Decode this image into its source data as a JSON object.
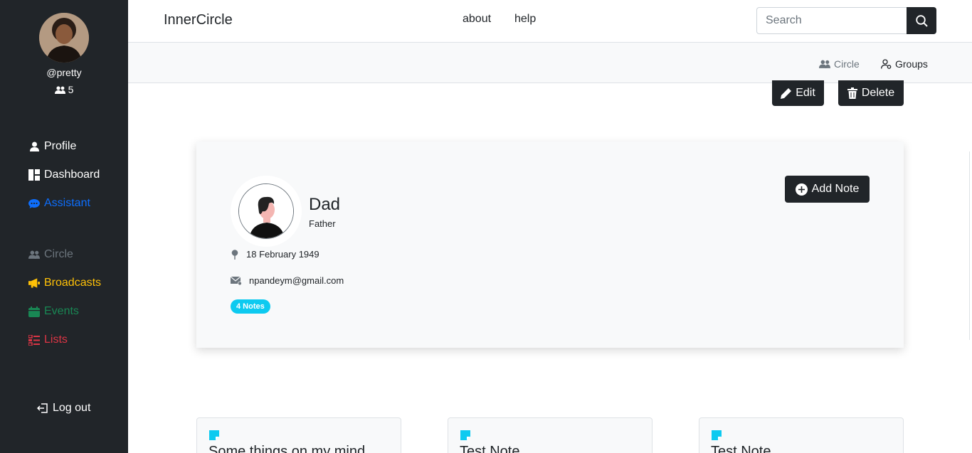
{
  "sidebar": {
    "username": "@pretty",
    "friend_count": "5",
    "nav": [
      {
        "label": "Profile",
        "color": "#ffffff",
        "icon": "person-icon"
      },
      {
        "label": "Dashboard",
        "color": "#ffffff",
        "icon": "dashboard-icon"
      },
      {
        "label": "Assistant",
        "color": "#0d6efd",
        "icon": "chat-icon"
      },
      {
        "label": "Circle",
        "color": "#6c757d",
        "icon": "people-icon"
      },
      {
        "label": "Broadcasts",
        "color": "#ffc107",
        "icon": "megaphone-icon"
      },
      {
        "label": "Events",
        "color": "#198754",
        "icon": "calendar-icon"
      },
      {
        "label": "Lists",
        "color": "#dc3545",
        "icon": "list-icon"
      }
    ],
    "logout_label": "Log out"
  },
  "topbar": {
    "brand": "InnerCircle",
    "links": [
      "about",
      "help"
    ],
    "search_placeholder": "Search"
  },
  "subbar": {
    "circle_label": "Circle",
    "groups_label": "Groups"
  },
  "actions": {
    "edit_label": "Edit",
    "delete_label": "Delete"
  },
  "contact": {
    "name": "Dad",
    "relation": "Father",
    "birthday": "18 February 1949",
    "email": "npandeym@gmail.com",
    "notes_badge": "4 Notes",
    "add_note_label": "Add Note"
  },
  "notes": [
    {
      "title": "Some things on my mind"
    },
    {
      "title": "Test Note"
    },
    {
      "title": "Test Note"
    }
  ],
  "colors": {
    "sidebar_bg": "#212529",
    "accent_info": "#0dcaf0"
  }
}
